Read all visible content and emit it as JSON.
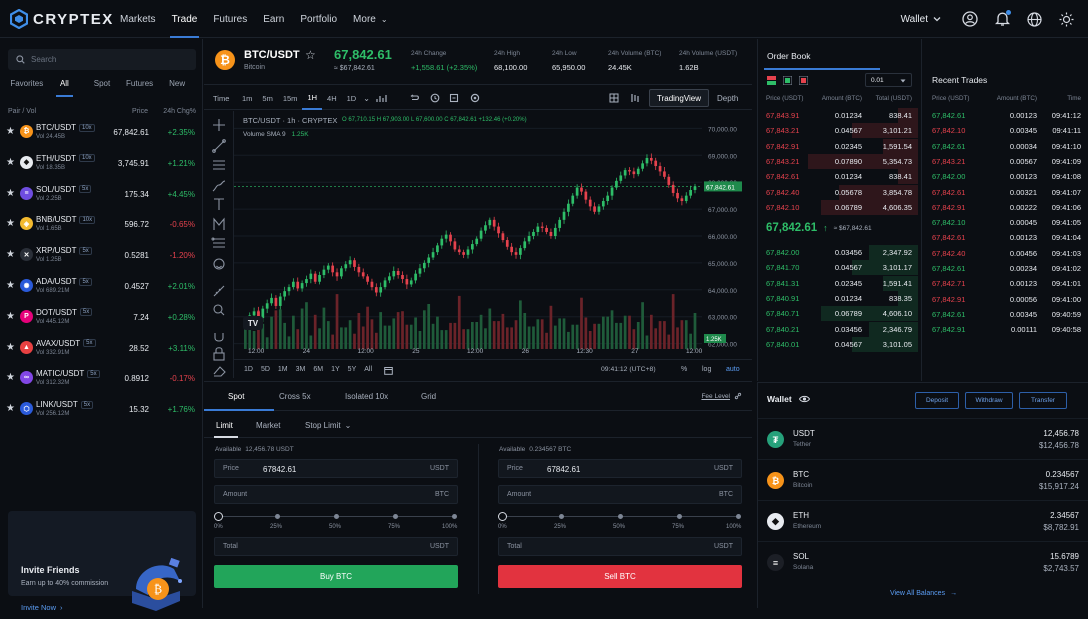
{
  "brand": {
    "name": "CRYPTEX"
  },
  "nav": {
    "items": [
      "Markets",
      "Trade",
      "Futures",
      "Earn",
      "Portfolio",
      "More"
    ],
    "active": "Trade"
  },
  "header_right": {
    "wallet": "Wallet"
  },
  "markets": {
    "search_placeholder": "Search",
    "tabs": [
      "Favorites",
      "All",
      "Spot",
      "Futures",
      "New"
    ],
    "active_tab": "All",
    "headers": {
      "pair": "Pair / Vol",
      "price": "Price",
      "change": "24h Chg%"
    },
    "rows": [
      {
        "pair": "BTC/USDT",
        "lev": "10x",
        "vol": "Vol 24.45B",
        "price": "67,842.61",
        "change": "+2.35%",
        "dir": "up",
        "color": "#f7931a",
        "glyph": "₿"
      },
      {
        "pair": "ETH/USDT",
        "lev": "10x",
        "vol": "Vol 18.35B",
        "price": "3,745.91",
        "change": "+1.21%",
        "dir": "up",
        "color": "#e8ebf0",
        "glyph": "◆"
      },
      {
        "pair": "SOL/USDT",
        "lev": "5x",
        "vol": "Vol 2.25B",
        "price": "175.34",
        "change": "+4.45%",
        "dir": "up",
        "color": "#6e4de0",
        "glyph": "≡"
      },
      {
        "pair": "BNB/USDT",
        "lev": "10x",
        "vol": "Vol 1.65B",
        "price": "596.72",
        "change": "-0.65%",
        "dir": "dn",
        "color": "#f3ba2f",
        "glyph": "◈"
      },
      {
        "pair": "XRP/USDT",
        "lev": "5x",
        "vol": "Vol 1.25B",
        "price": "0.5281",
        "change": "-1.20%",
        "dir": "dn",
        "color": "#2a2f38",
        "glyph": "✕"
      },
      {
        "pair": "ADA/USDT",
        "lev": "5x",
        "vol": "Vol 689.21M",
        "price": "0.4527",
        "change": "+2.01%",
        "dir": "up",
        "color": "#2a5ada",
        "glyph": "✺"
      },
      {
        "pair": "DOT/USDT",
        "lev": "5x",
        "vol": "Vol 445.12M",
        "price": "7.24",
        "change": "+0.28%",
        "dir": "up",
        "color": "#e6007a",
        "glyph": "P"
      },
      {
        "pair": "AVAX/USDT",
        "lev": "5x",
        "vol": "Vol 332.91M",
        "price": "28.52",
        "change": "+3.11%",
        "dir": "up",
        "color": "#e84142",
        "glyph": "▲"
      },
      {
        "pair": "MATIC/USDT",
        "lev": "5x",
        "vol": "Vol 312.32M",
        "price": "0.8912",
        "change": "-0.17%",
        "dir": "dn",
        "color": "#8247e5",
        "glyph": "∞"
      },
      {
        "pair": "LINK/USDT",
        "lev": "5x",
        "vol": "Vol 256.12M",
        "price": "15.32",
        "change": "+1.76%",
        "dir": "up",
        "color": "#2a5ada",
        "glyph": "⬡"
      }
    ]
  },
  "invite": {
    "title": "Invite Friends",
    "subtitle": "Earn up to 40% commission",
    "link": "Invite Now"
  },
  "ticker": {
    "pair": "BTC/USDT",
    "name": "Bitcoin",
    "price": "67,842.61",
    "price_usd": "≈ $67,842.61",
    "change_label": "24h Change",
    "change": "+1,558.61 (+2.35%)",
    "high_label": "24h High",
    "high": "68,100.00",
    "low_label": "24h Low",
    "low": "65,950.00",
    "volb_label": "24h Volume (BTC)",
    "volb": "24.45K",
    "volu_label": "24h Volume (USDT)",
    "volu": "1.62B"
  },
  "chart_toolbar": {
    "time": "Time",
    "intervals": [
      "1m",
      "5m",
      "15m",
      "1H",
      "4H",
      "1D"
    ],
    "active_interval": "1H",
    "views": [
      "TradingView",
      "Depth"
    ],
    "active_view": "TradingView"
  },
  "chart_legend": {
    "title": "BTC/USDT · 1h · CRYPTEX",
    "ohlc": "O 67,710.15  H 67,903.00  L 67,600.00  C 67,842.61  +132.46 (+0.20%)",
    "volume": "Volume  SMA 9",
    "volume_val": "1.25K"
  },
  "chart_data": {
    "type": "candlestick",
    "price_axis": {
      "ticks": [
        "70,000.00",
        "69,000.00",
        "68,000.00",
        "67,000.00",
        "66,000.00",
        "65,000.00",
        "64,000.00",
        "63,000.00",
        "62,000.00"
      ],
      "ylim": [
        61800,
        70200
      ],
      "last": 67842.61,
      "last_label": "67,842.61",
      "vol_label": "1.25K"
    },
    "time_axis": {
      "labels": [
        "12:00",
        "24",
        "12:00",
        "25",
        "12:00",
        "26",
        "12:30",
        "27",
        "12:00"
      ]
    },
    "close": [
      62800,
      63050,
      63200,
      62950,
      63300,
      63500,
      63700,
      63400,
      63750,
      63950,
      64100,
      64300,
      64050,
      64250,
      64400,
      64600,
      64300,
      64550,
      64750,
      64900,
      64650,
      64500,
      64800,
      64950,
      65100,
      64850,
      64650,
      64500,
      64300,
      64100,
      63900,
      64100,
      64350,
      64500,
      64700,
      64550,
      64400,
      64200,
      64350,
      64600,
      64800,
      65000,
      65200,
      65400,
      65650,
      65900,
      66050,
      65800,
      65500,
      65400,
      65300,
      65500,
      65700,
      65900,
      66200,
      66400,
      66600,
      66350,
      66100,
      65850,
      65600,
      65400,
      65300,
      65550,
      65800,
      66000,
      66150,
      66350,
      66300,
      66150,
      66000,
      66300,
      66600,
      66900,
      67200,
      67500,
      67800,
      67650,
      67350,
      67100,
      66900,
      67100,
      67300,
      67500,
      67800,
      68050,
      68250,
      68450,
      68400,
      68300,
      68500,
      68700,
      68900,
      68800,
      68600,
      68400,
      68200,
      67900,
      67600,
      67400,
      67300,
      67500,
      67710,
      67842
    ]
  },
  "chart_time": {
    "ranges": [
      "1D",
      "5D",
      "1M",
      "3M",
      "6M",
      "1Y",
      "5Y",
      "All"
    ],
    "clock": "09:41:12 (UTC+8)",
    "pct": "%",
    "log": "log",
    "auto": "auto"
  },
  "order_entry": {
    "tabs": [
      "Spot",
      "Cross 5x",
      "Isolated 10x",
      "Grid"
    ],
    "active_tab": "Spot",
    "fee": "Fee Level",
    "types": [
      "Limit",
      "Market",
      "Stop Limit"
    ],
    "active_type": "Limit",
    "buy": {
      "available_label": "Available",
      "available": "12,456.78 USDT",
      "price_label": "Price",
      "price": "67842.61",
      "price_unit": "USDT",
      "amount_label": "Amount",
      "amount_unit": "BTC",
      "total_label": "Total",
      "total_unit": "USDT",
      "button": "Buy BTC"
    },
    "sell": {
      "available_label": "Available",
      "available": "0.234567 BTC",
      "price_label": "Price",
      "price": "67842.61",
      "price_unit": "USDT",
      "amount_label": "Amount",
      "amount_unit": "BTC",
      "total_label": "Total",
      "total_unit": "USDT",
      "button": "Sell BTC"
    },
    "slider_marks": [
      "0%",
      "25%",
      "50%",
      "75%",
      "100%"
    ],
    "slider_value": 0
  },
  "order_book": {
    "title": "Order Book",
    "precision": "0.01",
    "headers": [
      "Price (USDT)",
      "Amount (BTC)",
      "Total (USDT)"
    ],
    "asks": [
      [
        "67,843.91",
        "0.01234",
        "838.41",
        0.18
      ],
      [
        "67,843.21",
        "0.04567",
        "3,101.21",
        0.6
      ],
      [
        "67,842.91",
        "0.02345",
        "1,591.54",
        0.32
      ],
      [
        "67,843.21",
        "0.07890",
        "5,354.73",
        1.0
      ],
      [
        "67,842.61",
        "0.01234",
        "838.41",
        0.18
      ],
      [
        "67,842.40",
        "0.05678",
        "3,854.78",
        0.72
      ],
      [
        "67,842.10",
        "0.06789",
        "4,606.35",
        0.88
      ]
    ],
    "mid_price": "67,842.61",
    "mid_usd": "≈ $67,842.61",
    "bids": [
      [
        "67,842.00",
        "0.03456",
        "2,347.92",
        0.45
      ],
      [
        "67,841.70",
        "0.04567",
        "3,101.17",
        0.6
      ],
      [
        "67,841.31",
        "0.02345",
        "1,591.41",
        0.32
      ],
      [
        "67,840.91",
        "0.01234",
        "838.35",
        0.18
      ],
      [
        "67,840.71",
        "0.06789",
        "4,606.10",
        0.88
      ],
      [
        "67,840.21",
        "0.03456",
        "2,346.79",
        0.45
      ],
      [
        "67,840.01",
        "0.04567",
        "3,101.05",
        0.6
      ]
    ]
  },
  "recent_trades": {
    "title": "Recent Trades",
    "headers": [
      "Price (USDT)",
      "Amount (BTC)",
      "Time"
    ],
    "rows": [
      [
        "67,842.61",
        "0.00123",
        "09:41:12",
        "up"
      ],
      [
        "67,842.10",
        "0.00345",
        "09:41:11",
        "dn"
      ],
      [
        "67,842.61",
        "0.00034",
        "09:41:10",
        "up"
      ],
      [
        "67,843.21",
        "0.00567",
        "09:41:09",
        "dn"
      ],
      [
        "67,842.00",
        "0.00123",
        "09:41:08",
        "up"
      ],
      [
        "67,842.61",
        "0.00321",
        "09:41:07",
        "dn"
      ],
      [
        "67,842.91",
        "0.00222",
        "09:41:06",
        "dn"
      ],
      [
        "67,842.10",
        "0.00045",
        "09:41:05",
        "up"
      ],
      [
        "67,842.61",
        "0.00123",
        "09:41:04",
        "dn"
      ],
      [
        "67,842.40",
        "0.00456",
        "09:41:03",
        "dn"
      ],
      [
        "67,842.61",
        "0.00234",
        "09:41:02",
        "up"
      ],
      [
        "67,842.71",
        "0.00123",
        "09:41:01",
        "dn"
      ],
      [
        "67,842.91",
        "0.00056",
        "09:41:00",
        "dn"
      ],
      [
        "67,842.61",
        "0.00345",
        "09:40:59",
        "up"
      ],
      [
        "67,842.91",
        "0.00111",
        "09:40:58",
        "up"
      ]
    ]
  },
  "wallet": {
    "title": "Wallet",
    "buttons": [
      "Deposit",
      "Withdraw",
      "Transfer"
    ],
    "assets": [
      {
        "sym": "USDT",
        "name": "Tether",
        "amount": "12,456.78",
        "fiat": "$12,456.78",
        "color": "#26a17b",
        "glyph": "₮"
      },
      {
        "sym": "BTC",
        "name": "Bitcoin",
        "amount": "0.234567",
        "fiat": "$15,917.24",
        "color": "#f7931a",
        "glyph": "₿"
      },
      {
        "sym": "ETH",
        "name": "Ethereum",
        "amount": "2.34567",
        "fiat": "$8,782.91",
        "color": "#e8ebf0",
        "glyph": "◆"
      },
      {
        "sym": "SOL",
        "name": "Solana",
        "amount": "15.6789",
        "fiat": "$2,743.57",
        "color": "#1c1f26",
        "glyph": "≡"
      }
    ],
    "view_all": "View All Balances"
  }
}
